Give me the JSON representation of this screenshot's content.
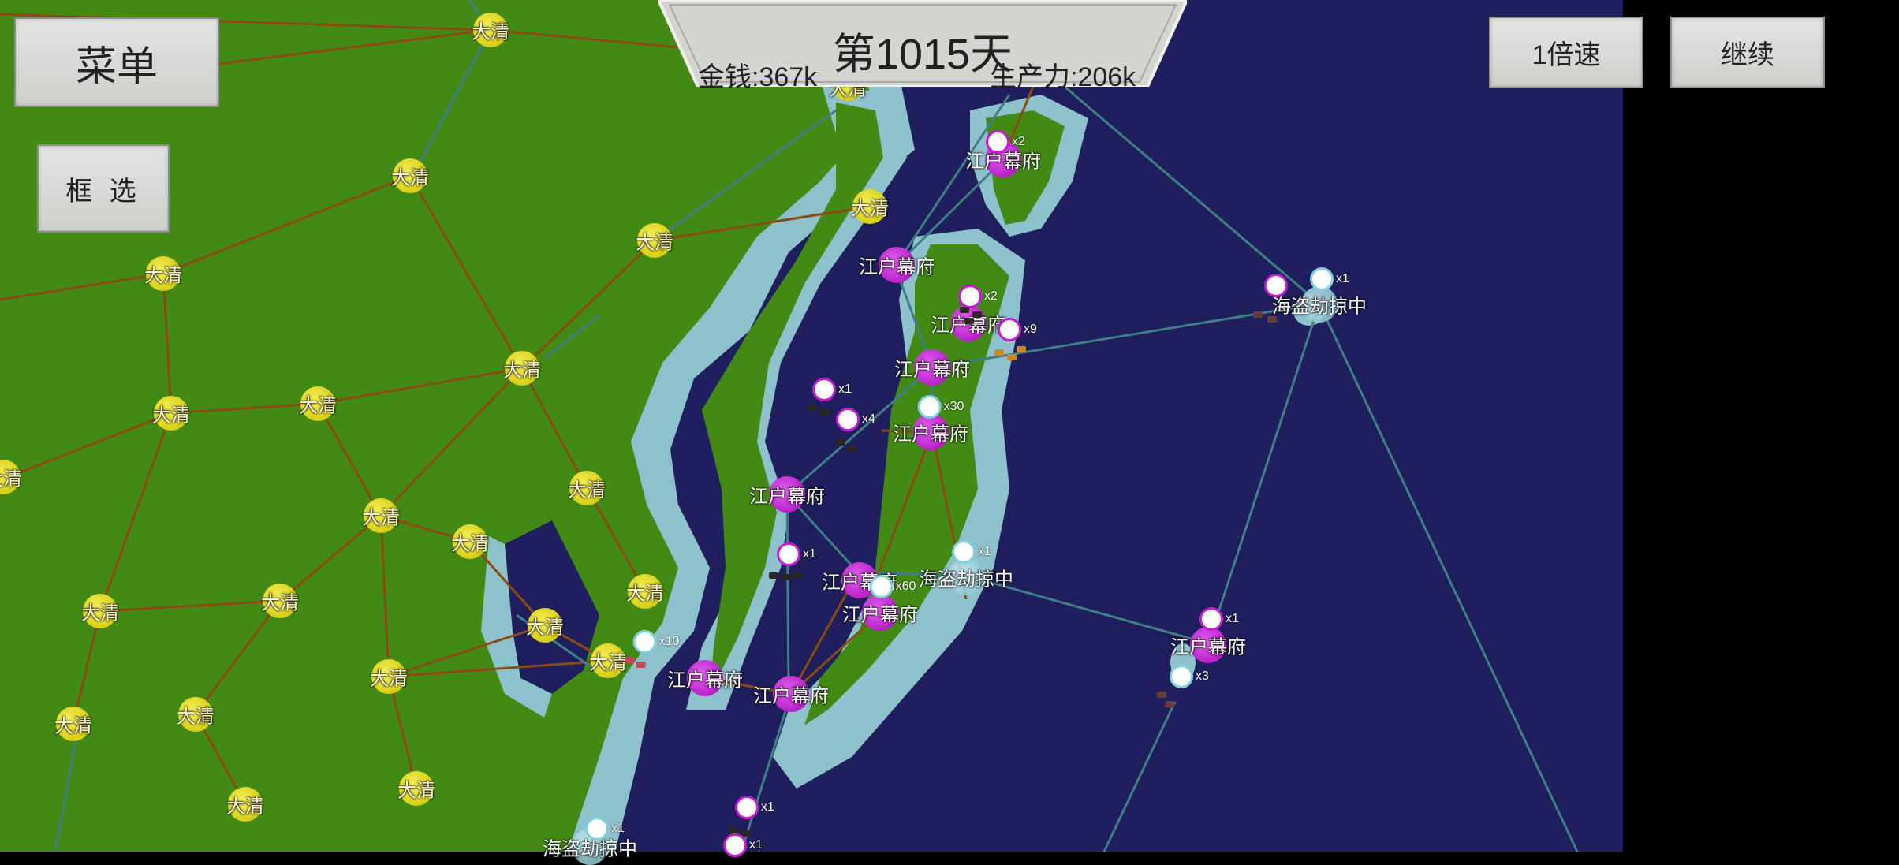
{
  "hud": {
    "day": "第1015天",
    "money": "金钱:367k",
    "production": "生产力:206k",
    "menu_label": "菜单",
    "select_label": "框 选",
    "speed_label": "1倍速",
    "continue_label": "继续"
  },
  "colors": {
    "land": "#438a14",
    "shallow_sea": "#8dc1cc",
    "deep_sea": "#1e1f5c",
    "qing_node": "#e0d61c",
    "edo_node": "#c321d3",
    "pirate_node": "#9fd4dc",
    "road_land": "#8a4b12",
    "road_sea": "#3f7f86"
  },
  "nodes": [
    {
      "id": "q1",
      "faction": "qing",
      "label": "大清"
    },
    {
      "id": "q2",
      "faction": "qing",
      "label": "大清"
    },
    {
      "id": "q3",
      "faction": "qing",
      "label": "大清"
    },
    {
      "id": "q4",
      "faction": "qing",
      "label": "大清"
    },
    {
      "id": "q5",
      "faction": "qing",
      "label": "大清"
    },
    {
      "id": "q6",
      "faction": "qing",
      "label": "大清"
    },
    {
      "id": "q7",
      "faction": "qing",
      "label": "大清"
    },
    {
      "id": "q8",
      "faction": "qing",
      "label": "大清"
    },
    {
      "id": "q9",
      "faction": "qing",
      "label": "大清"
    },
    {
      "id": "q10",
      "faction": "qing",
      "label": "大清"
    },
    {
      "id": "q11",
      "faction": "qing",
      "label": "大清"
    },
    {
      "id": "q12",
      "faction": "qing",
      "label": "大清"
    },
    {
      "id": "q13",
      "faction": "qing",
      "label": "大清"
    },
    {
      "id": "q14",
      "faction": "qing",
      "label": "大清"
    },
    {
      "id": "q15",
      "faction": "qing",
      "label": "大清"
    },
    {
      "id": "q16",
      "faction": "qing",
      "label": "大清"
    },
    {
      "id": "q17",
      "faction": "qing",
      "label": "大清"
    },
    {
      "id": "q18",
      "faction": "qing",
      "label": "大清"
    },
    {
      "id": "q19",
      "faction": "qing",
      "label": "大清"
    },
    {
      "id": "q20",
      "faction": "qing",
      "label": "大清"
    },
    {
      "id": "q21",
      "faction": "qing",
      "label": "大清"
    },
    {
      "id": "q22",
      "faction": "qing",
      "label": "大清"
    },
    {
      "id": "q23",
      "faction": "qing",
      "label": "大清"
    },
    {
      "id": "e1",
      "faction": "edo",
      "label": "江户幕府"
    },
    {
      "id": "e2",
      "faction": "edo",
      "label": "江户幕府"
    },
    {
      "id": "e3",
      "faction": "edo",
      "label": "江户幕府"
    },
    {
      "id": "e4",
      "faction": "edo",
      "label": "江户幕府"
    },
    {
      "id": "e5",
      "faction": "edo",
      "label": "江户幕府"
    },
    {
      "id": "e6",
      "faction": "edo",
      "label": "江户幕府"
    },
    {
      "id": "e7",
      "faction": "edo",
      "label": "江户幕府"
    },
    {
      "id": "e8",
      "faction": "edo",
      "label": "江户幕府"
    },
    {
      "id": "e9",
      "faction": "edo",
      "label": "江户幕府"
    },
    {
      "id": "e10",
      "faction": "edo",
      "label": "江户幕府"
    },
    {
      "id": "e11",
      "faction": "edo",
      "label": "江户幕府"
    },
    {
      "id": "p1",
      "faction": "pirate",
      "label": "海盗劫掠中"
    },
    {
      "id": "p2",
      "faction": "pirate",
      "label": "海盗劫掠中"
    },
    {
      "id": "p3",
      "faction": "pirate",
      "label": "海盗劫掠中"
    }
  ],
  "units": [
    {
      "id": "u1",
      "count": "x2",
      "style": "purple"
    },
    {
      "id": "u2",
      "count": "x2",
      "style": "purple"
    },
    {
      "id": "u3",
      "count": "x9",
      "style": "purple"
    },
    {
      "id": "u4",
      "count": "x1",
      "style": "purple"
    },
    {
      "id": "u5",
      "count": "x4",
      "style": "purple"
    },
    {
      "id": "u6",
      "count": "x30",
      "style": "white"
    },
    {
      "id": "u7",
      "count": "x1",
      "style": "purple"
    },
    {
      "id": "u8",
      "count": "x1",
      "style": "white"
    },
    {
      "id": "u9",
      "count": "x60",
      "style": "white"
    },
    {
      "id": "u10",
      "count": "x10",
      "style": "white"
    },
    {
      "id": "u11",
      "count": "x1",
      "style": "purple"
    },
    {
      "id": "u12",
      "count": "x3",
      "style": "white"
    },
    {
      "id": "u13",
      "count": "x1",
      "style": "white"
    },
    {
      "id": "u14",
      "count": "x1",
      "style": "purple"
    },
    {
      "id": "u15",
      "count": "x1",
      "style": "purple"
    },
    {
      "id": "u16",
      "count": "x1",
      "style": "white"
    }
  ]
}
